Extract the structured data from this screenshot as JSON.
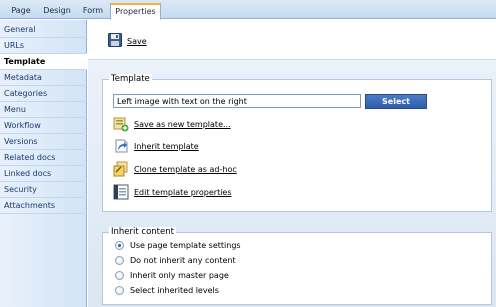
{
  "tabs": [
    {
      "label": "Page",
      "active": false
    },
    {
      "label": "Design",
      "active": false
    },
    {
      "label": "Form",
      "active": false
    },
    {
      "label": "Properties",
      "active": true
    }
  ],
  "sidebar": {
    "items": [
      {
        "label": "General",
        "active": false
      },
      {
        "label": "URLs",
        "active": false
      },
      {
        "label": "Template",
        "active": true
      },
      {
        "label": "Metadata",
        "active": false
      },
      {
        "label": "Categories",
        "active": false
      },
      {
        "label": "Menu",
        "active": false
      },
      {
        "label": "Workflow",
        "active": false
      },
      {
        "label": "Versions",
        "active": false
      },
      {
        "label": "Related docs",
        "active": false
      },
      {
        "label": "Linked docs",
        "active": false
      },
      {
        "label": "Security",
        "active": false
      },
      {
        "label": "Attachments",
        "active": false
      }
    ]
  },
  "toolbar": {
    "save_label": "Save",
    "save_icon": "floppy-disk-icon"
  },
  "template": {
    "title": "Template",
    "input_value": "Left image with text on the right",
    "select_label": "Select",
    "actions": [
      {
        "label": "Save as new template...",
        "icon": "save-template-icon"
      },
      {
        "label": "Inherit template",
        "icon": "inherit-template-icon"
      },
      {
        "label": "Clone template as ad-hoc",
        "icon": "clone-template-icon"
      },
      {
        "label": "Edit template properties",
        "icon": "edit-properties-icon"
      }
    ]
  },
  "inherit": {
    "title": "Inherit content",
    "options": [
      {
        "label": "Use page template settings",
        "selected": true
      },
      {
        "label": "Do not inherit any content",
        "selected": false
      },
      {
        "label": "Inherit only master page",
        "selected": false
      },
      {
        "label": "Select inherited levels",
        "selected": false
      }
    ]
  },
  "colors": {
    "accent": "#f2b33d",
    "select_button": "#2f5ea8",
    "sidebar_text": "#1c3a6e"
  }
}
